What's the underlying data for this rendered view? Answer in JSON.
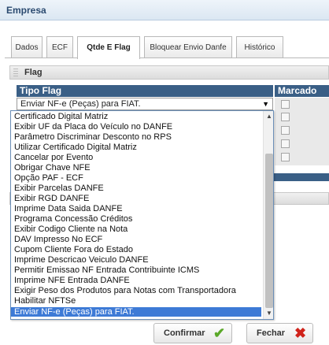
{
  "window": {
    "title": "Empresa"
  },
  "tabs": [
    "Dados",
    "ECF",
    "Qtde E Flag",
    "Bloquear Envio Danfe",
    "Histórico"
  ],
  "panel": {
    "title": "Flag"
  },
  "grid": {
    "columns": [
      "Tipo Flag",
      "Marcado"
    ]
  },
  "select": {
    "value": "Enviar NF-e (Peças) para FIAT."
  },
  "dropdown": {
    "options": [
      "Certificado Digital Matriz",
      "Exibir UF da Placa do Veículo no DANFE",
      "Parâmetro Discriminar Desconto no RPS",
      "Utilizar Certificado Digital Matriz",
      "Cancelar por Evento",
      "Obrigar Chave NFE",
      "Opção PAF - ECF",
      "Exibir Parcelas DANFE",
      "Exibir RGD DANFE",
      "Imprime Data Saida DANFE",
      "Programa Concessão Créditos",
      "Exibir Codigo Cliente na Nota",
      "DAV Impresso No ECF",
      "Cupom Cliente Fora do Estado",
      "Imprime Descricao Veiculo DANFE",
      "Permitir Emissao NF Entrada Contribuinte ICMS",
      "Imprime NFE Entrada DANFE",
      "Exigir Peso dos Produtos para Notas com Transportadora",
      "Habilitar NFTSe",
      "Enviar NF-e (Peças) para FIAT."
    ],
    "selected_index": 19
  },
  "buttons": {
    "confirm": "Confirmar",
    "close": "Fechar"
  },
  "colors": {
    "header": "#3a5f86",
    "selection": "#3d7ad6",
    "confirm_icon": "#5aa828",
    "close_icon": "#d0231b"
  }
}
